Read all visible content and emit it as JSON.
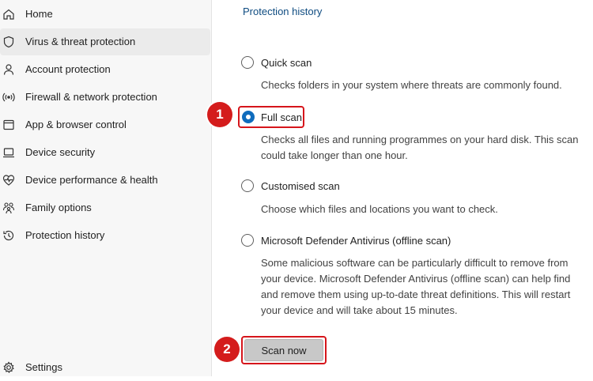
{
  "sidebar": {
    "items": [
      {
        "label": "Home",
        "icon": "home-icon"
      },
      {
        "label": "Virus & threat protection",
        "icon": "shield-icon",
        "selected": true
      },
      {
        "label": "Account protection",
        "icon": "person-icon"
      },
      {
        "label": "Firewall & network protection",
        "icon": "wifi-signal-icon"
      },
      {
        "label": "App & browser control",
        "icon": "app-window-icon"
      },
      {
        "label": "Device security",
        "icon": "laptop-icon"
      },
      {
        "label": "Device performance & health",
        "icon": "heart-pulse-icon"
      },
      {
        "label": "Family options",
        "icon": "family-icon"
      },
      {
        "label": "Protection history",
        "icon": "history-icon"
      }
    ],
    "settings_label": "Settings"
  },
  "main": {
    "breadcrumb": "Protection history",
    "options": [
      {
        "label": "Quick scan",
        "description": "Checks folders in your system where threats are commonly found.",
        "checked": false
      },
      {
        "label": "Full scan",
        "description": "Checks all files and running programmes on your hard disk. This scan could take longer than one hour.",
        "checked": true
      },
      {
        "label": "Customised scan",
        "description": "Choose which files and locations you want to check.",
        "checked": false
      },
      {
        "label": "Microsoft Defender Antivirus (offline scan)",
        "description": "Some malicious software can be particularly difficult to remove from your device. Microsoft Defender Antivirus (offline scan) can help find and remove them using up-to-date threat definitions. This will restart your device and will take about 15 minutes.",
        "checked": false
      }
    ],
    "scan_button_label": "Scan now"
  },
  "annotations": {
    "step1": "1",
    "step2": "2",
    "highlight_color": "#d6151b",
    "badge_color": "#d41c1c"
  },
  "colors": {
    "accent": "#0f6cbd",
    "link": "#0f4c81",
    "sidebar_bg": "#f7f7f7"
  }
}
